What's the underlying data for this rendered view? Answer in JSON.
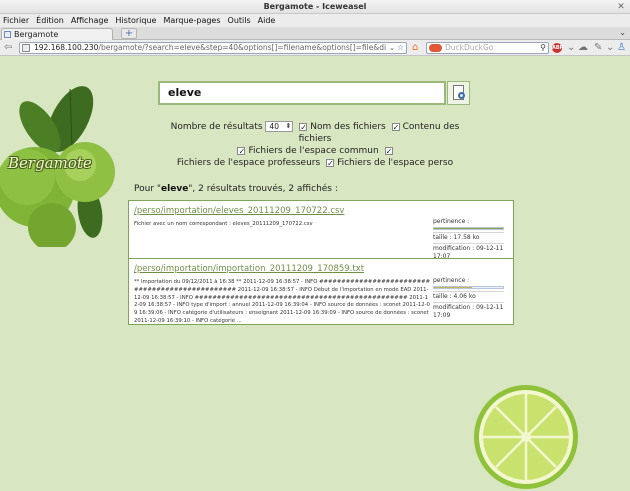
{
  "window": {
    "title": "Bergamote - Iceweasel"
  },
  "menu": [
    "Fichier",
    "Édition",
    "Affichage",
    "Historique",
    "Marque-pages",
    "Outils",
    "Aide"
  ],
  "tabs": [
    {
      "label": "Bergamote"
    }
  ],
  "address": {
    "host": "192.168.100.230",
    "path": "/bergamote/?search=eleve&step=40&options[]=filename&options[]=file&di"
  },
  "searchbox": {
    "placeholder": "DuckDuckGo"
  },
  "brand": {
    "name": "Bergamote"
  },
  "search": {
    "value": "eleve"
  },
  "options": {
    "count_label": "Nombre de résultats",
    "count_value": "40",
    "filename_label": "Nom des fichiers",
    "content_label": "Contenu des fichiers",
    "common_label": "Fichiers de l'espace commun",
    "teachers_label": "Fichiers de l'espace professeurs",
    "personal_label": "Fichiers de l'espace perso",
    "checkmark": "✓"
  },
  "summary": {
    "prefix": "Pour \"",
    "query": "eleve",
    "suffix": "\", 2 résultats trouvés, 2 affichés :"
  },
  "results": [
    {
      "link": "/perso/importation/eleves_20111209_170722.csv",
      "description": "Fichier avec un nom correspondant : eleves_20111209_170722.csv",
      "relevance_label": "pertinence :",
      "relevance": 1.0,
      "size": "taille : 17.58 ko",
      "modified": "modification : 09-12-11 17:07"
    },
    {
      "link": "/perso/importation/importation_20111209_170859.txt",
      "description": "** Importation du 09/12/2011 à 16:38 ** 2011-12-09 16:38:57 - INFO ################################################ 2011-12-09 16:38:57 - INFO Début de l'importation en mode EAD 2011-12-09 16:38:57 - INFO ################################################ 2011-12-09 16:38:57 - INFO type d'import : annuel 2011-12-09 16:39:04 - INFO source de données : sconet 2011-12-09 16:39:06 - INFO catégorie d'utilisateurs : enseignant 2011-12-09 16:39:09 - INFO source de données : sconet 2011-12-09 16:39:10 - INFO catégorie ...",
      "relevance_label": "pertinence :",
      "relevance": 0.55,
      "size": "taille : 4.06 ko",
      "modified": "modification : 09-12-11 17:09"
    }
  ],
  "colors": {
    "page_background": "#d9e6c2",
    "accent": "#6f8f47",
    "relevance_high": "#8aa64a",
    "relevance_mid": "#c2b85a"
  }
}
